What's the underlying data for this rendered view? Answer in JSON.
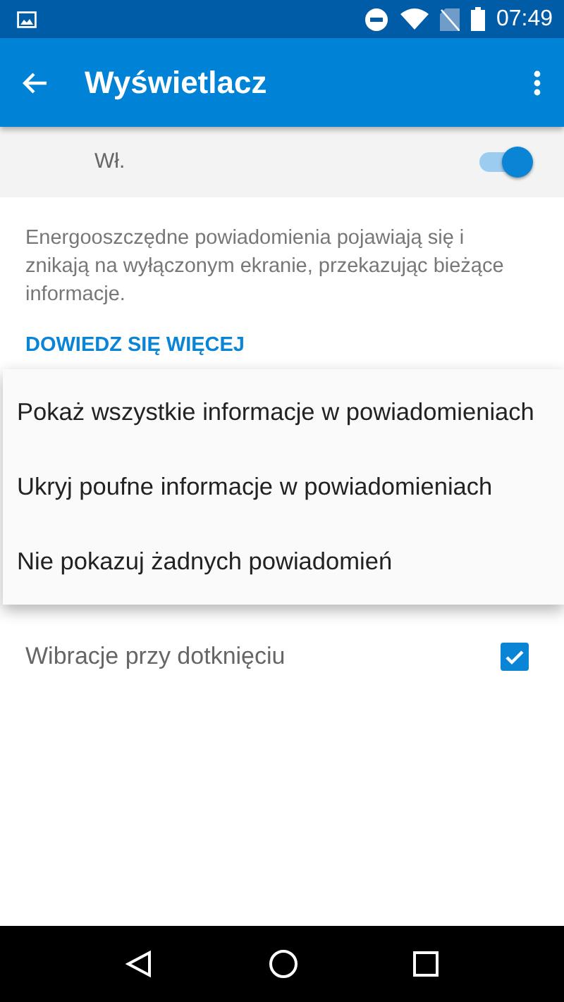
{
  "status_bar": {
    "time": "07:49"
  },
  "toolbar": {
    "title": "Wyświetlacz"
  },
  "master_switch": {
    "label": "Wł.",
    "on": true
  },
  "description": "Energooszczędne powiadomienia pojawiają się i znikają na wyłączonym ekranie, przekazując bieżące informacje.",
  "learn_more_link": "DOWIEDZ SIĘ WIĘCEJ",
  "popup_menu": {
    "items": [
      {
        "label": "Pokaż wszystkie informacje w powiadomieniach"
      },
      {
        "label": "Ukryj poufne informacje w powiadomieniach"
      },
      {
        "label": "Nie pokazuj żadnych powiadomień"
      }
    ]
  },
  "settings": [
    {
      "label": "Wibracje przy dotknięciu",
      "checked": true
    }
  ]
}
